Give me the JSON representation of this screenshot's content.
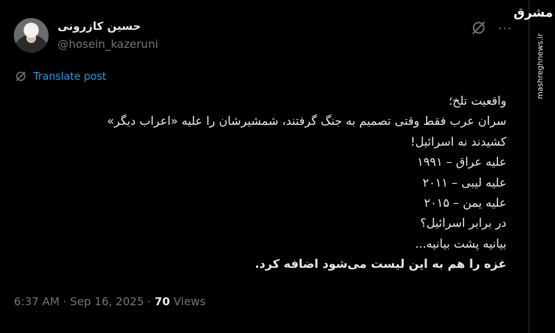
{
  "author": {
    "display_name": "حسین کازرونی",
    "handle": "@hosein_kazeruni"
  },
  "header": {
    "grok_icon": "grok-icon",
    "more_label": "..."
  },
  "translate": {
    "icon": "translate-icon",
    "label": "Translate post"
  },
  "post": {
    "lines": [
      "واقعیت تلخ؛",
      "سران عرب فقط وقتی تصمیم به جنگ گرفتند، شمشیرشان را علیه «اعراب دیگر»",
      "کشیدند نه اسرائیل!",
      "علیه عراق – ۱۹۹۱",
      "علیه لیبی – ۲۰۱۱",
      "علیه یمن – ۲۰۱۵",
      "در برابر اسرائیل؟",
      "بیانیه پشت بیانیه...",
      "غزه را هم به این لیست می‌شود اضافه کرد."
    ]
  },
  "meta": {
    "time": "6:37 AM",
    "separator1": " · ",
    "date": "Sep 16, 2025",
    "separator2": " · ",
    "views_count": "70",
    "views_label": " Views"
  },
  "watermark": {
    "logo": "مشرق",
    "url": "mashreghnews.ir"
  },
  "colors": {
    "background": "#000000",
    "text": "#e7e9ea",
    "muted": "#71767b",
    "link": "#1d9bf0"
  }
}
